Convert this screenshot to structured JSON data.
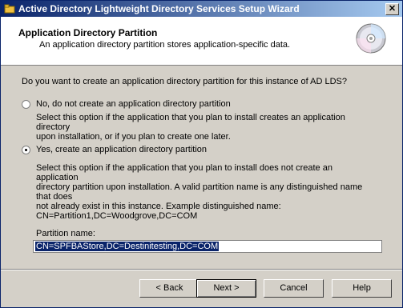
{
  "window": {
    "title": "Active Directory Lightweight Directory Services Setup Wizard"
  },
  "titlebar": {
    "app_icon": "folder-icon",
    "close_glyph": "✕"
  },
  "header": {
    "title": "Application Directory Partition",
    "subtitle": "An application directory partition stores application-specific data.",
    "icon": "cd-icon"
  },
  "question": "Do you want to create an application directory partition for this instance of AD LDS?",
  "options": [
    {
      "label": "No, do not create an application directory partition",
      "selected": false,
      "description": [
        "Select this option if the application that you plan to install creates an application directory",
        "upon installation, or if you plan to create one later."
      ]
    },
    {
      "label": "Yes, create an application directory partition",
      "selected": true,
      "description": [
        "Select this option if the application that you plan to install does not create an application",
        "directory partition upon installation. A valid partition name is any distinguished name that does",
        "not already exist in this instance. Example distinguished name:",
        "CN=Partition1,DC=Woodgrove,DC=COM"
      ]
    }
  ],
  "partition": {
    "label": "Partition name:",
    "value": "CN=SPFBAStore,DC=Destinitesting,DC=COM"
  },
  "buttons": {
    "back": "< Back",
    "next": "Next >",
    "cancel": "Cancel",
    "help": "Help"
  }
}
